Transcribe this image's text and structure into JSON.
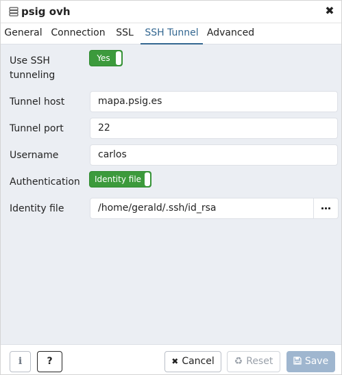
{
  "window": {
    "title": "psig ovh",
    "close_glyph": "✖"
  },
  "tabs": [
    {
      "label": "General"
    },
    {
      "label": "Connection"
    },
    {
      "label": "SSL"
    },
    {
      "label": "SSH Tunnel",
      "active": true
    },
    {
      "label": "Advanced"
    }
  ],
  "form": {
    "use_ssh": {
      "label_line1": "Use SSH",
      "label_line2": "tunneling",
      "toggle_label": "Yes"
    },
    "tunnel_host": {
      "label": "Tunnel host",
      "value": "mapa.psig.es"
    },
    "tunnel_port": {
      "label": "Tunnel port",
      "value": "22"
    },
    "username": {
      "label": "Username",
      "value": "carlos"
    },
    "authentication": {
      "label": "Authentication",
      "toggle_label": "Identity file"
    },
    "identity_file": {
      "label": "Identity file",
      "value": "/home/gerald/.ssh/id_rsa",
      "browse_icon": "ellipsis-icon"
    }
  },
  "footer": {
    "info_glyph": "i",
    "help_glyph": "?",
    "cancel_label": "Cancel",
    "cancel_glyph": "✖",
    "reset_label": "Reset",
    "reset_glyph": "♻",
    "save_label": "Save",
    "save_glyph": "💾"
  },
  "colors": {
    "accent": "#326690",
    "toggle_on": "#3c9a3c",
    "save_disabled": "#9fb6cf"
  }
}
